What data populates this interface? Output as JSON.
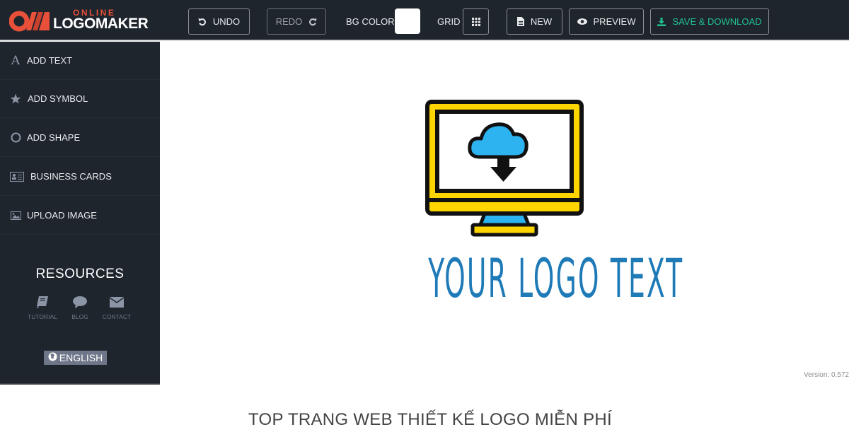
{
  "app": {
    "logo_top": "ONLINE",
    "logo_main": "LOGOMAKER",
    "brand_color": "#e8503a"
  },
  "toolbar": {
    "undo_label": "UNDO",
    "redo_label": "REDO",
    "bg_color_label": "BG COLOR",
    "bg_color_value": "#ffffff",
    "grid_label": "GRID",
    "new_label": "NEW",
    "preview_label": "PREVIEW",
    "save_label": "SAVE & DOWNLOAD",
    "save_color": "#22c38e"
  },
  "sidebar": {
    "items": [
      {
        "label": "ADD TEXT",
        "icon": "text-icon"
      },
      {
        "label": "ADD SYMBOL",
        "icon": "star-icon"
      },
      {
        "label": "ADD SHAPE",
        "icon": "circle-icon"
      },
      {
        "label": "BUSINESS CARDS",
        "icon": "id-card-icon"
      },
      {
        "label": "UPLOAD IMAGE",
        "icon": "image-icon"
      }
    ],
    "resources_title": "RESOURCES",
    "resources": [
      {
        "label": "TUTORIAL",
        "icon": "book-icon"
      },
      {
        "label": "BLOG",
        "icon": "comment-icon"
      },
      {
        "label": "CONTACT",
        "icon": "envelope-icon"
      }
    ],
    "language": "ENGLISH"
  },
  "canvas": {
    "logo_text": "YOUR LOGO TEXT",
    "logo_text_color": "#1f7ab8",
    "symbol": "computer-cloud-download",
    "version": "Version: 0.572"
  },
  "footer": {
    "title": "TOP TRANG WEB THIẾT KẾ LOGO MIỄN PHÍ"
  }
}
